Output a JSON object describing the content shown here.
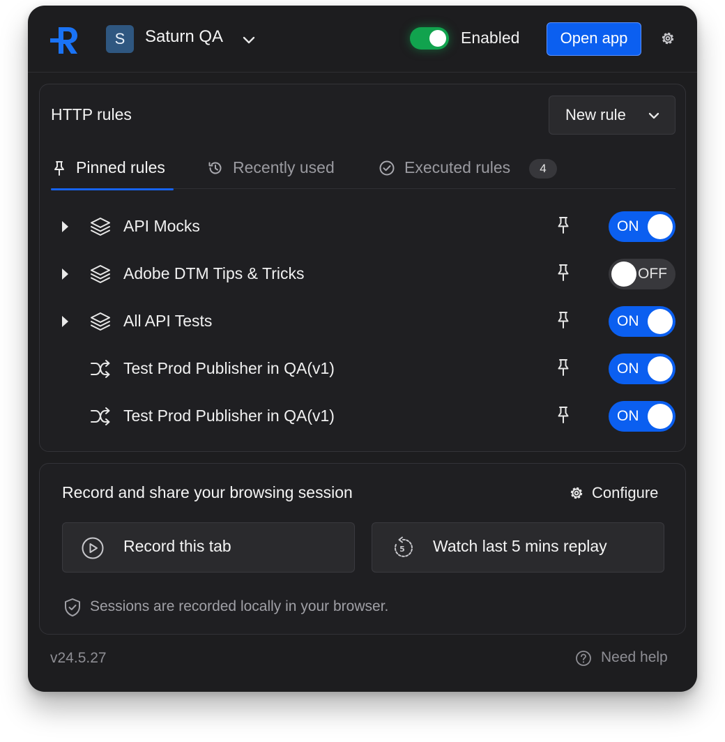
{
  "header": {
    "workspace_initial": "S",
    "workspace_name": "Saturn QA",
    "enabled_label": "Enabled",
    "open_app_label": "Open app",
    "accent_color": "#0b5ff0",
    "enabled_color": "#11a34e"
  },
  "rules": {
    "title": "HTTP rules",
    "new_rule_label": "New rule",
    "tabs": [
      {
        "label": "Pinned rules",
        "icon": "pin-icon",
        "active": true
      },
      {
        "label": "Recently used",
        "icon": "history-icon",
        "active": false
      },
      {
        "label": "Executed rules",
        "icon": "check-circle-icon",
        "active": false,
        "count": "4"
      }
    ],
    "items": [
      {
        "name": "API Mocks",
        "type_icon": "layers-icon",
        "expandable": true,
        "state": "ON"
      },
      {
        "name": "Adobe DTM Tips & Tricks",
        "type_icon": "layers-icon",
        "expandable": true,
        "state": "OFF"
      },
      {
        "name": "All API Tests",
        "type_icon": "layers-icon",
        "expandable": true,
        "state": "ON"
      },
      {
        "name": "Test Prod Publisher in QA(v1)",
        "type_icon": "shuffle-icon",
        "expandable": false,
        "state": "ON"
      },
      {
        "name": "Test Prod Publisher in QA(v1)",
        "type_icon": "shuffle-icon",
        "expandable": false,
        "state": "ON"
      }
    ]
  },
  "session": {
    "title": "Record and share your browsing session",
    "configure_label": "Configure",
    "record_label": "Record this tab",
    "replay_label": "Watch last 5 mins replay",
    "note": "Sessions are recorded locally in your browser."
  },
  "footer": {
    "version": "v24.5.27",
    "help_label": "Need help"
  }
}
